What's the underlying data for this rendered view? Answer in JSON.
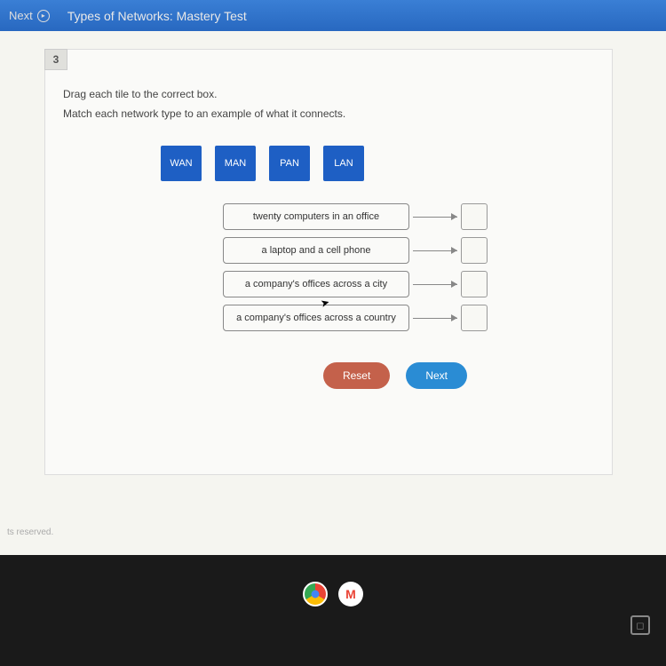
{
  "header": {
    "next_label": "Next",
    "title": "Types of Networks: Mastery Test"
  },
  "question": {
    "number": "3",
    "instruction_1": "Drag each tile to the correct box.",
    "instruction_2": "Match each network type to an example of what it connects."
  },
  "tiles": [
    "WAN",
    "MAN",
    "PAN",
    "LAN"
  ],
  "matches": [
    "twenty computers in an office",
    "a laptop and a cell phone",
    "a company's offices across a city",
    "a company's offices across a country"
  ],
  "buttons": {
    "reset": "Reset",
    "next": "Next"
  },
  "footer": "ts reserved.",
  "gmail_letter": "M"
}
